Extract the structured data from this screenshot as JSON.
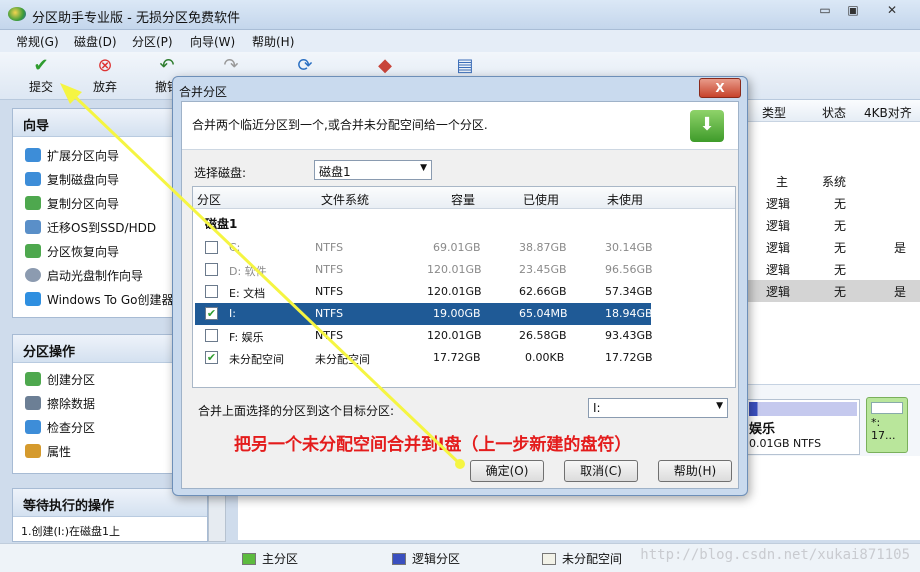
{
  "window": {
    "title": "分区助手专业版 - 无损分区免费软件",
    "min": "▭",
    "restore": "▣",
    "close": "✕"
  },
  "menu": [
    "常规(G)",
    "磁盘(D)",
    "分区(P)",
    "向导(W)",
    "帮助(H)"
  ],
  "toolbar": [
    {
      "label": "提交",
      "icon": "check-icon",
      "glyph": "✔",
      "color": "#2f9c2f"
    },
    {
      "label": "放弃",
      "icon": "discard-icon",
      "glyph": "⊗",
      "color": "#d33"
    },
    {
      "label": "撤销",
      "icon": "undo-icon",
      "glyph": "↶",
      "color": "#2f7d2f"
    },
    {
      "label": "",
      "icon": "redo-icon",
      "glyph": "↷",
      "color": "#999"
    },
    {
      "label": "",
      "icon": "refresh-icon",
      "glyph": "⟳",
      "color": "#2a6fc2"
    },
    {
      "label": "",
      "icon": "cube-icon",
      "glyph": "◆",
      "color": "#c8443a"
    },
    {
      "label": "",
      "icon": "disk-icon",
      "glyph": "▤",
      "color": "#3b6db8"
    }
  ],
  "wizard_panel": {
    "title": "向导",
    "items": [
      "扩展分区向导",
      "复制磁盘向导",
      "复制分区向导",
      "迁移OS到SSD/HDD",
      "分区恢复向导",
      "启动光盘制作向导",
      "Windows To Go创建器"
    ]
  },
  "ops_panel": {
    "title": "分区操作",
    "items": [
      "创建分区",
      "擦除数据",
      "检查分区",
      "属性"
    ]
  },
  "pending_panel": {
    "title": "等待执行的操作",
    "items": [
      "1.创建(I:)在磁盘1上"
    ]
  },
  "grid": {
    "headers": [
      "类型",
      "状态",
      "4KB对齐"
    ],
    "rows": [
      {
        "type": "主",
        "status": "系统",
        "align": ""
      },
      {
        "type": "逻辑",
        "status": "无",
        "align": ""
      },
      {
        "type": "逻辑",
        "status": "无",
        "align": ""
      },
      {
        "type": "逻辑",
        "status": "无",
        "align": "是"
      },
      {
        "type": "逻辑",
        "status": "无",
        "align": ""
      },
      {
        "type": "逻辑",
        "status": "无",
        "align": "是"
      }
    ]
  },
  "disk_map": {
    "block1_name": "娱乐",
    "block1_info": "0.01GB NTFS",
    "block2_name": "*:",
    "block2_info": "17..."
  },
  "legend": {
    "primary": "主分区",
    "logical": "逻辑分区",
    "unallocated": "未分配空间",
    "watermark": "http://blog.csdn.net/xukai871105"
  },
  "dialog": {
    "title": "合并分区",
    "close": "X",
    "description": "合并两个临近分区到一个,或合并未分配空间给一个分区.",
    "select_disk_label": "选择磁盘:",
    "select_disk_value": "磁盘1",
    "columns": [
      "分区",
      "文件系统",
      "容量",
      "已使用",
      "未使用"
    ],
    "disk_group": "磁盘1",
    "partitions": [
      {
        "name": "C:",
        "fs": "NTFS",
        "capacity": "69.01GB",
        "used": "38.87GB",
        "free": "30.14GB",
        "checked": false,
        "state": "dim"
      },
      {
        "name": "D: 软件",
        "fs": "NTFS",
        "capacity": "120.01GB",
        "used": "23.45GB",
        "free": "96.56GB",
        "checked": false,
        "state": "dim"
      },
      {
        "name": "E: 文档",
        "fs": "NTFS",
        "capacity": "120.01GB",
        "used": "62.66GB",
        "free": "57.34GB",
        "checked": false,
        "state": "normal"
      },
      {
        "name": "I:",
        "fs": "NTFS",
        "capacity": "19.00GB",
        "used": "65.04MB",
        "free": "18.94GB",
        "checked": true,
        "state": "sel"
      },
      {
        "name": "F: 娱乐",
        "fs": "NTFS",
        "capacity": "120.01GB",
        "used": "26.58GB",
        "free": "93.43GB",
        "checked": false,
        "state": "normal"
      },
      {
        "name": "未分配空间",
        "fs": "未分配空间",
        "capacity": "17.72GB",
        "used": "0.00KB",
        "free": "17.72GB",
        "checked": true,
        "state": "normal"
      }
    ],
    "merge_target_label": "合并上面选择的分区到这个目标分区:",
    "merge_target_value": "I:",
    "annotation": "把另一个未分配空间合并到I盘（上一步新建的盘符）",
    "ok": "确定(O)",
    "cancel": "取消(C)",
    "help": "帮助(H)"
  },
  "colors": {
    "annotation": "#e41c1c",
    "arrow": "#f5f542",
    "selection": "#1f5a96"
  }
}
